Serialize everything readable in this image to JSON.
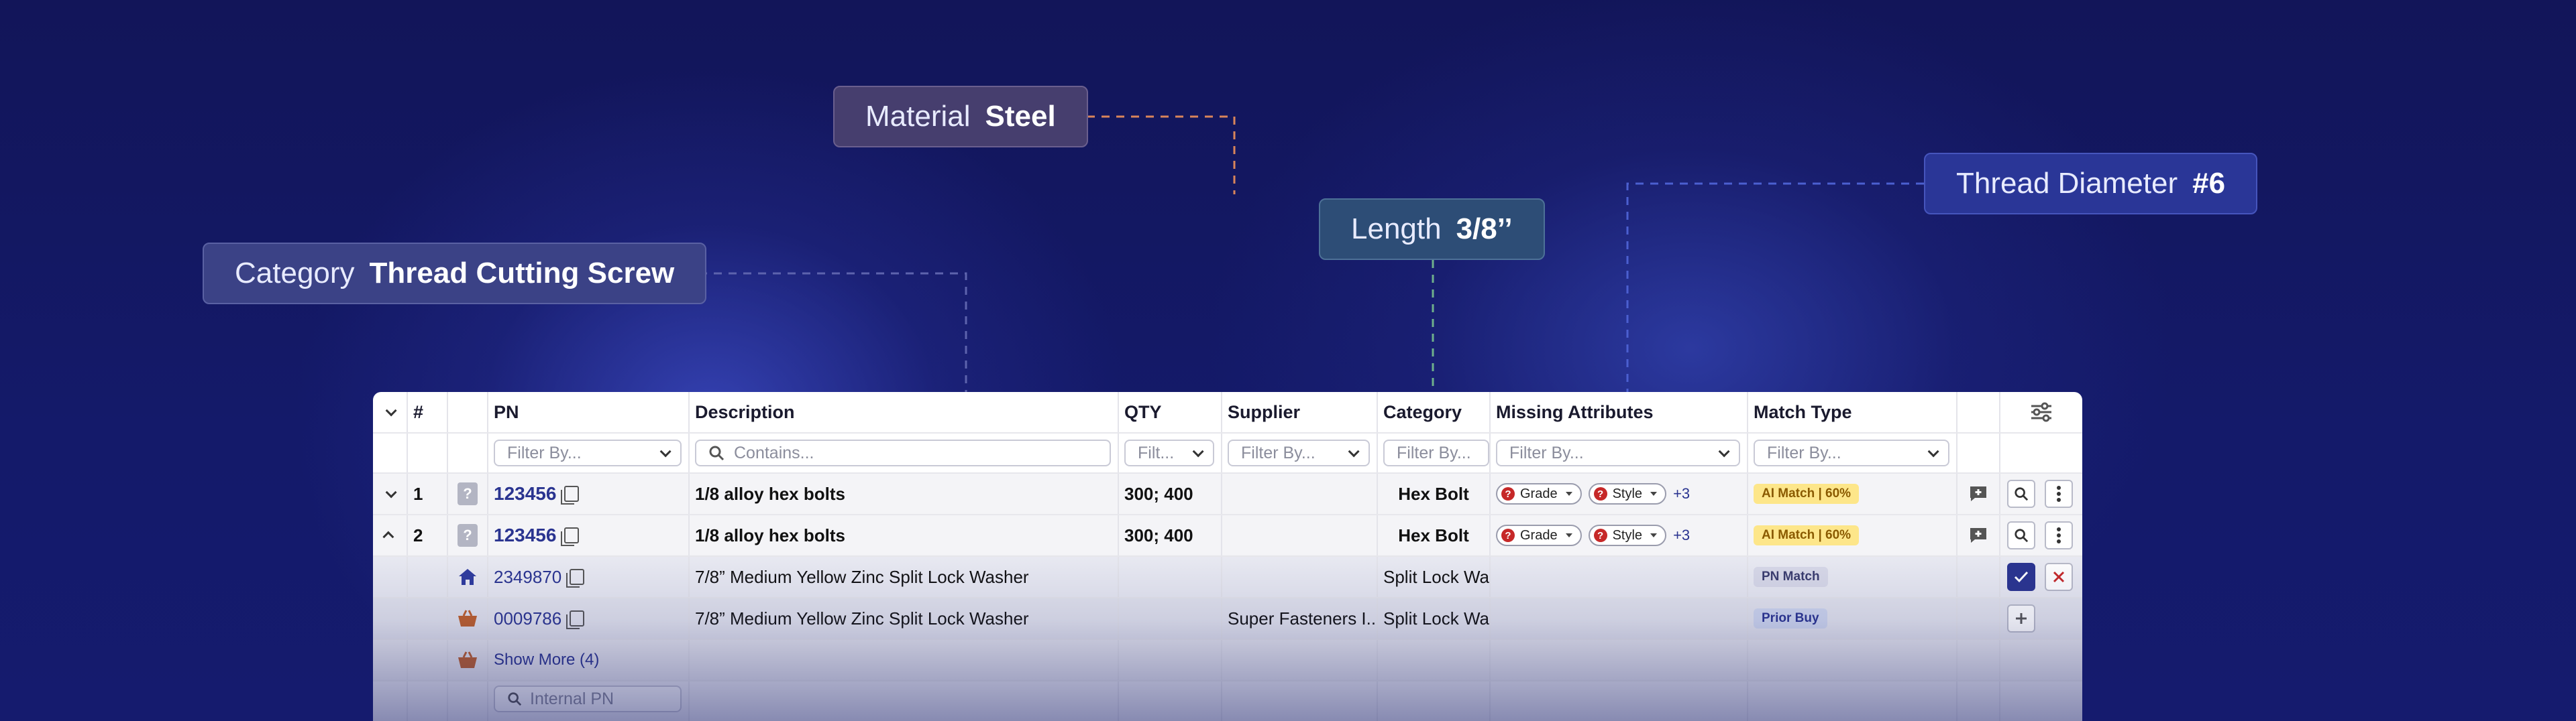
{
  "tags": {
    "category": {
      "label": "Category",
      "value": "Thread Cutting Screw"
    },
    "material": {
      "label": "Material",
      "value": "Steel"
    },
    "length": {
      "label": "Length",
      "value": "3/8’’"
    },
    "thread": {
      "label": "Thread Diameter",
      "value": "#6"
    }
  },
  "table": {
    "headers": {
      "num": "#",
      "pn": "PN",
      "description": "Description",
      "qty": "QTY",
      "supplier": "Supplier",
      "category": "Category",
      "missing": "Missing Attributes",
      "match": "Match Type"
    },
    "filters": {
      "pn": "Filter By...",
      "description": "Contains...",
      "qty": "Filt...",
      "supplier": "Filter By...",
      "category": "Filter By...",
      "missing": "Filter By...",
      "match": "Filter By..."
    },
    "rows": [
      {
        "num": "1",
        "pn": "123456",
        "description": "1/8 alloy hex bolts",
        "qty": "300; 400",
        "category": "Hex Bolt",
        "chip1": "Grade",
        "chip2": "Style",
        "more": "+3",
        "match": "AI Match | 60%"
      },
      {
        "num": "2",
        "pn": "123456",
        "description": "1/8 alloy hex bolts",
        "qty": "300; 400",
        "category": "Hex Bolt",
        "chip1": "Grade",
        "chip2": "Style",
        "more": "+3",
        "match": "AI Match | 60%"
      }
    ],
    "subrows": [
      {
        "pn": "2349870",
        "description": "7/8” Medium Yellow Zinc Split Lock Washer",
        "supplier": "",
        "category": "Split Lock Was",
        "match": "PN Match"
      },
      {
        "pn": "0009786",
        "description": "7/8” Medium Yellow Zinc Split Lock Washer",
        "supplier": "Super Fasteners I...",
        "category": "Split Lock Was",
        "match": "Prior Buy"
      }
    ],
    "show_more": "Show More (4)",
    "internal_pn_placeholder": "Internal PN"
  },
  "colors": {
    "background": "#121660",
    "accent": "#2a3490",
    "ai_badge": "#fde68a",
    "danger": "#c62828"
  }
}
